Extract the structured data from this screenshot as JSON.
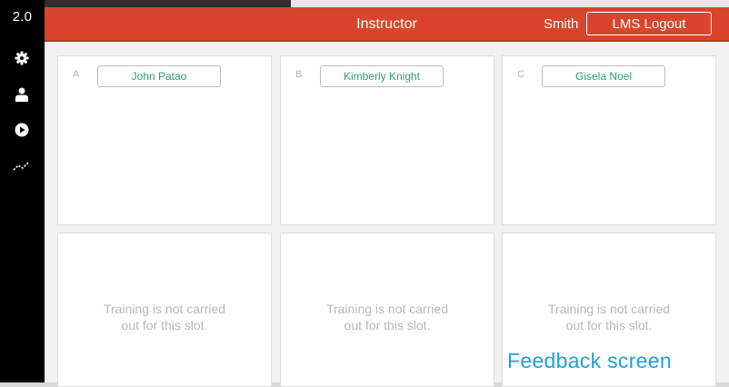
{
  "version": "2.0",
  "sidebar": {
    "icons": [
      {
        "name": "settings-icon"
      },
      {
        "name": "user-icon"
      },
      {
        "name": "play-icon"
      },
      {
        "name": "chart-line-icon"
      }
    ]
  },
  "header": {
    "title": "Instructor",
    "user_name": "Smith",
    "logout_label": "LMS Logout"
  },
  "slots": [
    {
      "letter": "A",
      "trainee": "John Patao"
    },
    {
      "letter": "B",
      "trainee": "Kimberly Knight"
    },
    {
      "letter": "C",
      "trainee": "Gisela Noel"
    }
  ],
  "empty_slots": [
    {
      "line1": "Training is not carried",
      "line2": "out for this slot."
    },
    {
      "line1": "Training is not carried",
      "line2": "out for this slot."
    },
    {
      "line1": "Training is not carried",
      "line2": "out for this slot."
    }
  ],
  "caption": "Feedback screen",
  "colors": {
    "header": "#d9452c",
    "accent_text": "#2b9e74",
    "caption": "#1e9fd8"
  }
}
